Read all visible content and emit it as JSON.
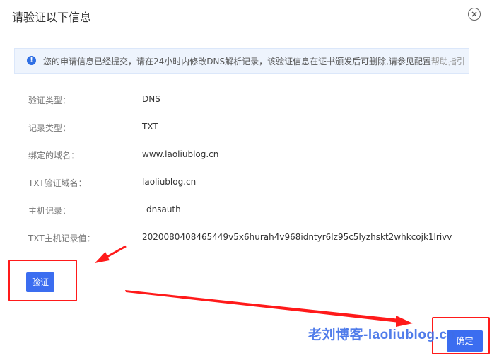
{
  "dialog": {
    "title": "请验证以下信息"
  },
  "notice": {
    "text": "您的申请信息已经提交，请在24小时内修改DNS解析记录，该验证信息在证书颁发后可删除,请参见配置",
    "help_link": "帮助指引"
  },
  "fields": [
    {
      "label": "验证类型：",
      "value": "DNS"
    },
    {
      "label": "记录类型：",
      "value": "TXT"
    },
    {
      "label": "绑定的域名：",
      "value": "www.laoliublog.cn"
    },
    {
      "label": "TXT验证域名：",
      "value": "laoliublog.cn"
    },
    {
      "label": "主机记录：",
      "value": "_dnsauth"
    },
    {
      "label": "TXT主机记录值：",
      "value": "2020080408465449v5x6hurah4v968idntyr6lz95c5lyzhskt2whkcojk1lrivv"
    }
  ],
  "buttons": {
    "verify": "验证",
    "ok": "确定"
  },
  "watermark": "老刘博客-laoliublog.cn",
  "colors": {
    "primary": "#3b6df0",
    "annotation": "#ff1a1a",
    "notice_bg": "#eef4fd"
  }
}
